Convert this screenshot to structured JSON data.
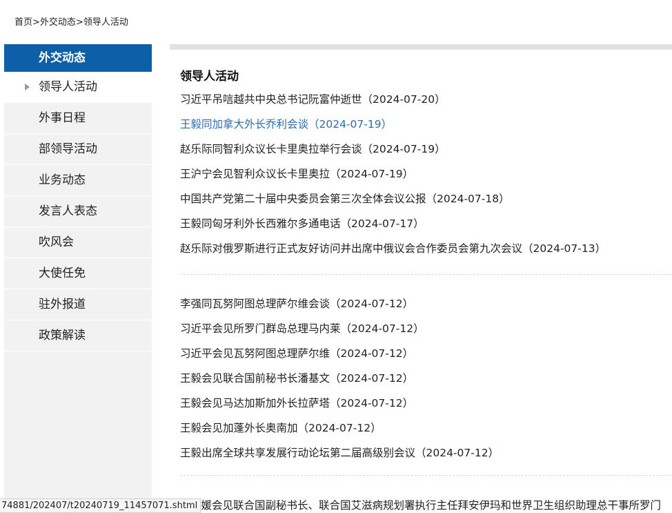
{
  "breadcrumb": {
    "home": "首页",
    "sep1": ">",
    "section": "外交动态",
    "sep2": ">",
    "current": "领导人活动"
  },
  "sidebar": {
    "header": "外交动态",
    "active": "领导人活动",
    "items": [
      "外事日程",
      "部领导活动",
      "业务动态",
      "发言人表态",
      "吹风会",
      "大使任免",
      "驻外报道",
      "政策解读"
    ]
  },
  "main": {
    "title": "领导人活动",
    "group1": [
      "习近平吊唁越共中央总书记阮富仲逝世（2024-07-20）",
      "王毅同加拿大外长乔利会谈（2024-07-19）",
      "赵乐际同智利众议长卡里奥拉举行会谈（2024-07-19）",
      "王沪宁会见智利众议长卡里奥拉（2024-07-19）",
      "中国共产党第二十届中央委员会第三次全体会议公报（2024-07-18）",
      "王毅同匈牙利外长西雅尔多通电话（2024-07-17）",
      "赵乐际对俄罗斯进行正式友好访问并出席中俄议会合作委员会第九次会议（2024-07-13）"
    ],
    "group2": [
      "李强同瓦努阿图总理萨尔维会谈（2024-07-12）",
      "习近平会见所罗门群岛总理马内莱（2024-07-12）",
      "习近平会见瓦努阿图总理萨尔维（2024-07-12）",
      "王毅会见联合国前秘书长潘基文（2024-07-12）",
      "王毅会见马达加斯加外长拉萨塔（2024-07-12）",
      "王毅会见加蓬外长奥南加（2024-07-12）",
      "王毅出席全球共享发展行动论坛第二届高级别会议（2024-07-12）"
    ],
    "cut_off": "丽媛会见联合国副秘书长、联合国艾滋病规划署执行主任拜安伊玛和世界卫生组织助理总干事所罗门"
  },
  "status_bar": "74881/202407/t20240719_11457071.shtml",
  "colors": {
    "sidebar_header": "#0d5fa8",
    "link_hover": "#2b6cb0",
    "sidebar_bg": "#f2f2f2"
  }
}
